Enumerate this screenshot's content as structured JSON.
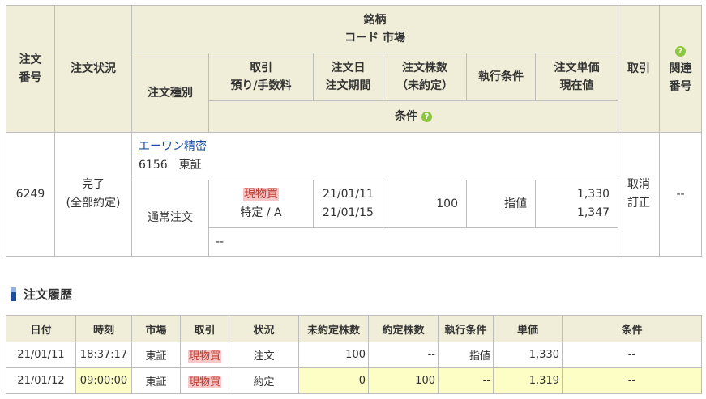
{
  "order_header": {
    "order_no": [
      "注文",
      "番号"
    ],
    "status": "注文状況",
    "brand": "銘柄",
    "code_market": "コード 市場",
    "order_type": "注文種別",
    "trade": [
      "取引",
      "預り/手数料"
    ],
    "order_date": [
      "注文日",
      "注文期間"
    ],
    "qty": [
      "注文株数",
      "（未約定）"
    ],
    "exec_cond": "執行条件",
    "price": [
      "注文単価",
      "現在値"
    ],
    "action": "取引",
    "related": [
      "関連",
      "番号"
    ],
    "conditions": "条件",
    "help_icon": "?"
  },
  "order_row": {
    "order_no": "6249",
    "status": [
      "完了",
      "(全部約定)"
    ],
    "stock_name": "エーワン精密",
    "stock_code_market": "6156　東証",
    "order_type": "通常注文",
    "trade_badge": "現物買",
    "trade_account": "特定 / A",
    "order_date": "21/01/11",
    "order_period": "21/01/15",
    "qty": "100",
    "exec_cond": "指値",
    "price": "1,330",
    "current_price": "1,347",
    "cancel": "取消",
    "modify": "訂正",
    "related": "--",
    "conditions": "--"
  },
  "history": {
    "title": "注文履歴",
    "columns": [
      "日付",
      "時刻",
      "市場",
      "取引",
      "状況",
      "未約定株数",
      "約定株数",
      "執行条件",
      "単価",
      "条件"
    ],
    "rows": [
      {
        "date": "21/01/11",
        "time": "18:37:17",
        "market": "東証",
        "trade": "現物買",
        "status": "注文",
        "unfilled": "100",
        "filled": "--",
        "exec": "指値",
        "price": "1,330",
        "cond": "--"
      },
      {
        "date": "21/01/12",
        "time": "09:00:00",
        "market": "東証",
        "trade": "現物買",
        "status": "約定",
        "unfilled": "0",
        "filled": "100",
        "exec": "--",
        "price": "1,319",
        "cond": "--"
      }
    ]
  },
  "colors": {
    "header_bg": "#f0eed8",
    "border": "#bdbdbd",
    "link": "#1a4fa0",
    "badge_bg": "#f7c6c8",
    "badge_text": "#c0392b",
    "highlight": "#fdfdc6",
    "help_icon": "#8cc63f"
  }
}
